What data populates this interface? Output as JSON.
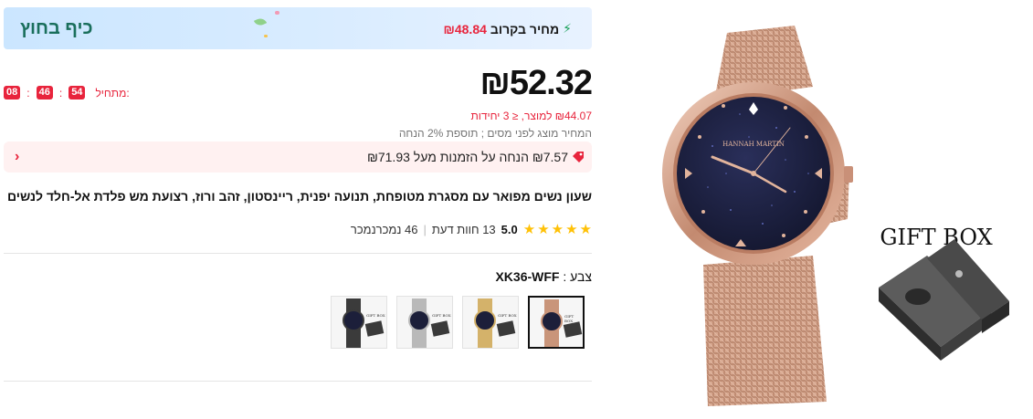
{
  "promo": {
    "left_text": "כיף בחוץ",
    "label": "מחיר בקרוב",
    "price": "₪48.84",
    "icon": "lightning-icon"
  },
  "price": {
    "main": "₪52.32",
    "unit": "₪44.07 למוצר, ≤ 3 יחידות",
    "tax_note": "המחיר מוצג לפני מסים ; תוספת 2% הנחה"
  },
  "timer": {
    "label": "מתחיל:",
    "hours": "08",
    "minutes": "46",
    "seconds": "54",
    "separator": ":"
  },
  "coupon": {
    "text": "₪7.57 הנחה על הזמנות מעל ₪71.93",
    "icon": "tag-icon",
    "chevron": "›"
  },
  "product": {
    "title": "שעון נשים מפואר עם מסגרת מטופחת, תנועה יפנית, ריינסטון, זהב ורוז, רצועת מש פלדת אל-חלד לנשים"
  },
  "rating": {
    "stars": 5,
    "score": "5.0",
    "reviews": "13 חוות דעת",
    "divider": "|",
    "sold": "46 נמכרנמכר"
  },
  "color": {
    "label": "צבע :",
    "value": "XK36-WFF",
    "options": [
      {
        "name": "rose-gold",
        "strap": "#c9957a",
        "selected": true
      },
      {
        "name": "gold",
        "strap": "#d4b26a",
        "selected": false
      },
      {
        "name": "silver",
        "strap": "#b9b9b9",
        "selected": false
      },
      {
        "name": "black",
        "strap": "#3b3b3b",
        "selected": false
      }
    ],
    "swatch_box_text": "GIFT BOX"
  },
  "hero": {
    "box_label": "GIFT BOX",
    "brand": "HANNAH MARTIN"
  },
  "colors": {
    "accent_red": "#e8243c",
    "promo_green": "#1a6f5c",
    "star": "#ffc107",
    "rose_gold": "#c9957a",
    "dial": "#1c1f3a"
  }
}
